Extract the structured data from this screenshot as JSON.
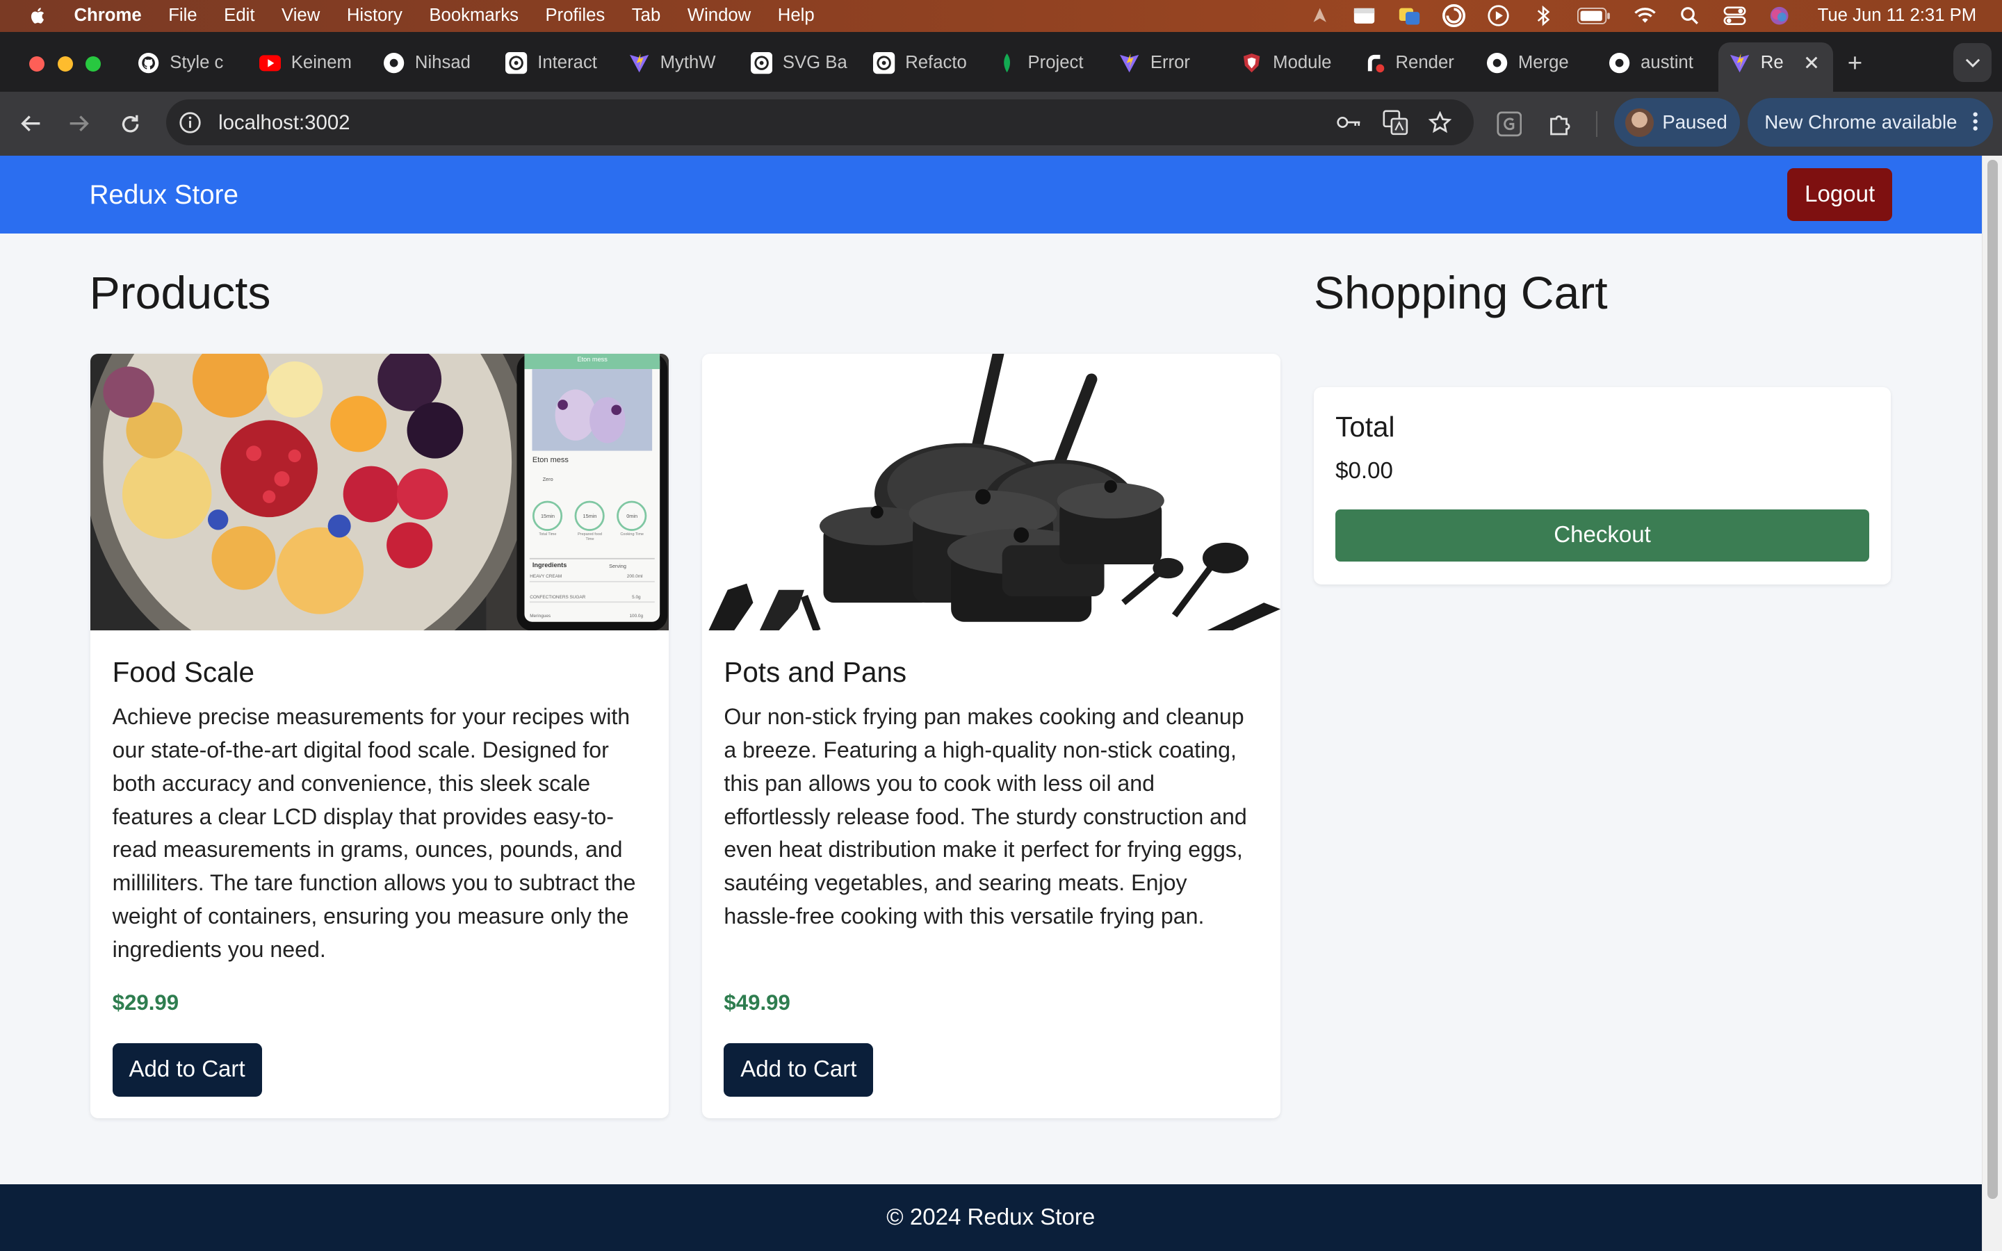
{
  "menubar": {
    "app_name": "Chrome",
    "items": [
      "File",
      "Edit",
      "View",
      "History",
      "Bookmarks",
      "Profiles",
      "Tab",
      "Window",
      "Help"
    ],
    "clock": "Tue Jun 11  2:31 PM"
  },
  "tabs": [
    {
      "label": "Style c",
      "icon": "github-icon"
    },
    {
      "label": "Keinem",
      "icon": "youtube-icon"
    },
    {
      "label": "Nihsad",
      "icon": "github-icon"
    },
    {
      "label": "Interact",
      "icon": "openai-icon"
    },
    {
      "label": "MythW",
      "icon": "vite-icon"
    },
    {
      "label": "SVG Ba",
      "icon": "openai-icon"
    },
    {
      "label": "Refacto",
      "icon": "openai-icon"
    },
    {
      "label": "Project",
      "icon": "mongodb-icon"
    },
    {
      "label": "Error",
      "icon": "vite-icon"
    },
    {
      "label": "Module",
      "icon": "shield-icon"
    },
    {
      "label": "Render",
      "icon": "render-icon"
    },
    {
      "label": "Merge",
      "icon": "github-icon"
    },
    {
      "label": "austint",
      "icon": "github-icon"
    },
    {
      "label": "Re",
      "icon": "vite-icon",
      "active": true
    }
  ],
  "toolbar": {
    "url": "localhost:3002",
    "profile_label": "Paused",
    "update_label": "New Chrome available"
  },
  "site": {
    "brand": "Redux Store",
    "logout_label": "Logout",
    "products_heading": "Products",
    "cart_heading": "Shopping Cart",
    "footer": "© 2024 Redux Store"
  },
  "products": [
    {
      "title": "Food Scale",
      "description": "Achieve precise measurements for your recipes with our state-of-the-art digital food scale. Designed for both accuracy and convenience, this sleek scale features a clear LCD display that provides easy-to-read measurements in grams, ounces, pounds, and milliliters. The tare function allows you to subtract the weight of containers, ensuring you measure only the ingredients you need.",
      "price": "$29.99",
      "button": "Add to Cart",
      "image": "fruit-bowl-and-phone-app",
      "phone_screen": {
        "header": "Eton mess",
        "title": "Eton mess",
        "badge": "Zero",
        "timers": [
          "15min",
          "15min",
          "0min"
        ],
        "timer_labels": [
          "Total Time",
          "Prepared food Time",
          "Cooking Time"
        ],
        "ingredients_label": "Ingredients",
        "serving_label": "Serving",
        "rows": [
          {
            "name": "HEAVY CREAM",
            "qty": "200.0ml"
          },
          {
            "name": "CONFECTIONERS SUGAR",
            "qty": "5.0g"
          },
          {
            "name": "Meringues",
            "qty": "100.0g"
          }
        ]
      }
    },
    {
      "title": "Pots and Pans",
      "description": "Our non-stick frying pan makes cooking and cleanup a breeze. Featuring a high-quality non-stick coating, this pan allows you to cook with less oil and effortlessly release food. The sturdy construction and even heat distribution make it perfect for frying eggs, sautéing vegetables, and searing meats. Enjoy hassle-free cooking with this versatile frying pan.",
      "price": "$49.99",
      "button": "Add to Cart",
      "image": "cookware-set"
    }
  ],
  "cart": {
    "total_label": "Total",
    "total_value": "$0.00",
    "checkout_label": "Checkout"
  },
  "colors": {
    "header_blue": "#2b6ef0",
    "logout_red": "#7e1010",
    "navy": "#0b1f3a",
    "price_green": "#2e7d4f",
    "checkout_green": "#3b7d53"
  }
}
